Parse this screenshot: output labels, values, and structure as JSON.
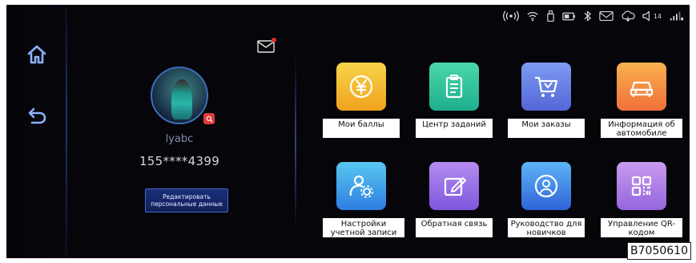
{
  "nav": {
    "home_icon": "home-icon",
    "back_icon": "back-arrow-icon"
  },
  "status_bar": {
    "icons": [
      "hotspot-icon",
      "wifi-icon",
      "usb-icon",
      "battery-icon",
      "bluetooth-icon",
      "mail-icon",
      "cloud-icon",
      "volume-icon",
      "signal-icon"
    ],
    "volume_level": "14"
  },
  "profile": {
    "username": "lyabc",
    "phone": "155****4399",
    "edit_button_label": "Редактировать персональные данные",
    "mail_has_unread": true
  },
  "apps": [
    {
      "label": "Мои баллы",
      "icon": "yen-coin-icon",
      "color_from": "#f7d44a",
      "color_to": "#f0a21d"
    },
    {
      "label": "Центр заданий",
      "icon": "clipboard-icon",
      "color_from": "#48d8a8",
      "color_to": "#1fae8d"
    },
    {
      "label": "Мои заказы",
      "icon": "shopping-cart-icon",
      "color_from": "#7d9bf2",
      "color_to": "#5566d8"
    },
    {
      "label": "Информация об автомобиле",
      "icon": "car-icon",
      "color_from": "#f9b24f",
      "color_to": "#ef6f39"
    },
    {
      "label": "Настройки учетной записи",
      "icon": "account-settings-icon",
      "color_from": "#57c7f0",
      "color_to": "#2e7ee0"
    },
    {
      "label": "Обратная связь",
      "icon": "feedback-edit-icon",
      "color_from": "#b68bf0",
      "color_to": "#7d57dc"
    },
    {
      "label": "Руководство для новичков",
      "icon": "user-guide-icon",
      "color_from": "#5db4f5",
      "color_to": "#3064d9"
    },
    {
      "label": "Управление QR-кодом",
      "icon": "qr-code-icon",
      "color_from": "#c99af0",
      "color_to": "#9466dc"
    }
  ],
  "watermark": "B7050610"
}
